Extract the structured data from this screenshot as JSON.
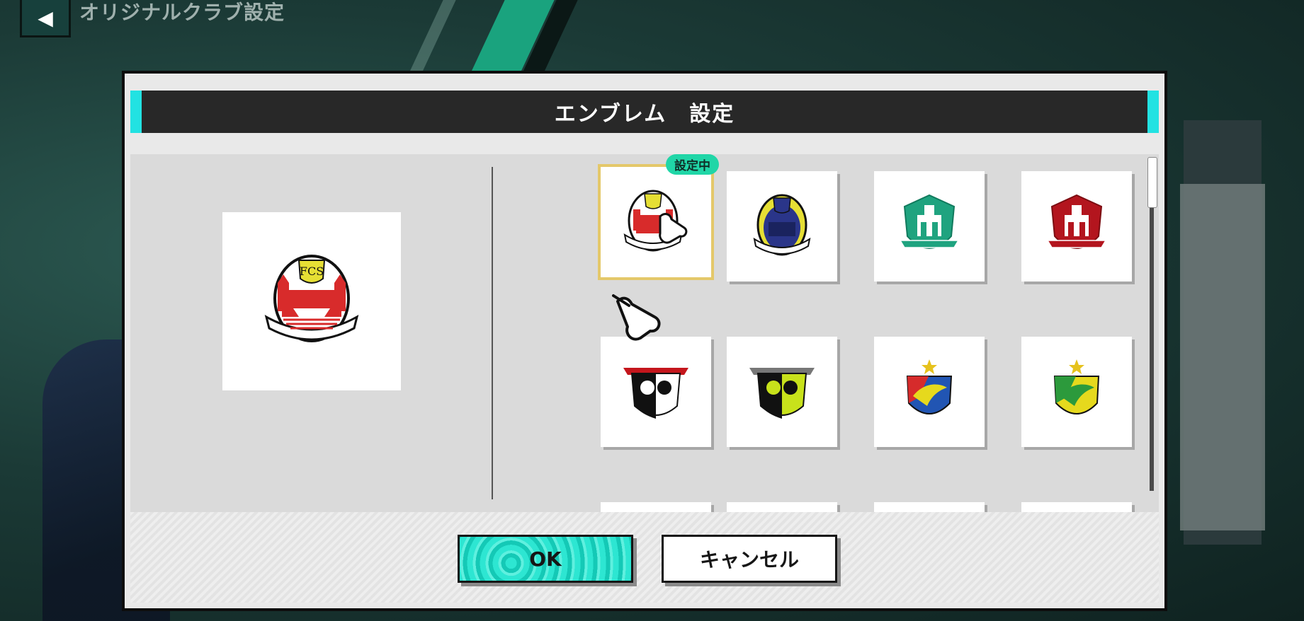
{
  "screen": {
    "title": "オリジナルクラブ設定",
    "back_label": "◀"
  },
  "dialog": {
    "title": "エンブレム　設定",
    "selected_badge": "設定中",
    "ok_label": "OK",
    "cancel_label": "キャンセル"
  },
  "emblems": [
    {
      "name": "fc-stuttgart-red",
      "shield_color": "#d82b2b",
      "accent_color": "#e6df34",
      "selected": true
    },
    {
      "name": "fc-stuttgart-navy",
      "shield_color": "#2a3589",
      "accent_color": "#e6df34",
      "selected": false
    },
    {
      "name": "castle-teal",
      "shield_color": "#1fa37f",
      "accent_color": "#ffffff",
      "selected": false
    },
    {
      "name": "castle-red",
      "shield_color": "#b3151e",
      "accent_color": "#ffffff",
      "selected": false
    },
    {
      "name": "eagle-black-red",
      "shield_color": "#111111",
      "accent_color": "#c4161c",
      "selected": false
    },
    {
      "name": "eagle-lime-grey",
      "shield_color": "#c8e21b",
      "accent_color": "#777777",
      "selected": false
    },
    {
      "name": "phoenix-blue-red",
      "shield_color": "#2155b3",
      "accent_color": "#d62b2b",
      "selected": false
    },
    {
      "name": "phoenix-yellow-green",
      "shield_color": "#e6d91d",
      "accent_color": "#2c9a3c",
      "selected": false
    }
  ],
  "colors": {
    "header_accent": "#22e2e2",
    "ok_button": "#20d6c2",
    "selected_outline": "#e4c86a"
  }
}
